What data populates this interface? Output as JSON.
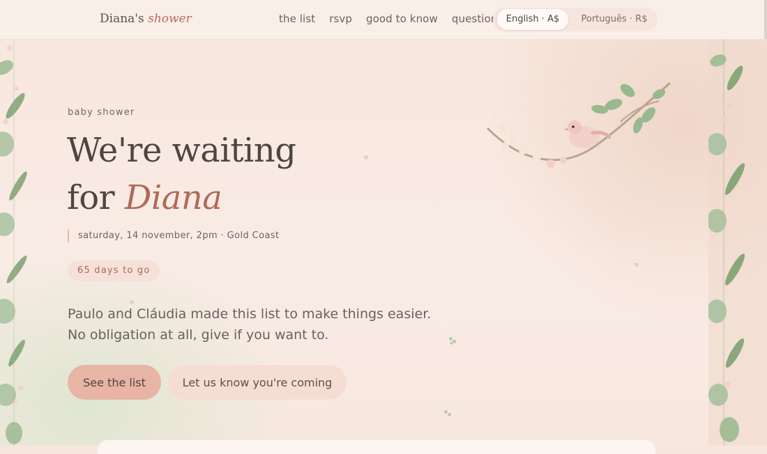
{
  "header": {
    "brand_name": "Diana's",
    "brand_accent": "shower",
    "nav": [
      {
        "label": "the list"
      },
      {
        "label": "rsvp"
      },
      {
        "label": "good to know"
      },
      {
        "label": "questions"
      }
    ],
    "languages": [
      {
        "label": "English · A$",
        "selected": true
      },
      {
        "label": "Português · R$",
        "selected": false
      }
    ]
  },
  "hero": {
    "eyebrow": "baby shower",
    "title_line1": "We're waiting",
    "title_for": "for",
    "title_name": "Diana",
    "date_line": "saturday, 14 november, 2pm · Gold Coast",
    "countdown": "65 days to go",
    "blurb_line1": "Paulo and Cláudia made this list to make things easier.",
    "blurb_line2": "No obligation at all, give if you want to.",
    "primary_button": "See the list",
    "secondary_button": "Let us know you're coming"
  },
  "decorations": {
    "left_border": "eucalyptus-leaves-icon",
    "right_border": "eucalyptus-leaves-icon",
    "branch": "bird-on-branch-icon",
    "sparkles": "blossom-sparkle-icon"
  },
  "colors": {
    "accent": "#ad6a59",
    "primary_button": "#e7b4a6",
    "secondary_button": "#f6ddd4",
    "background": "#f7e7de",
    "leaf_green": "#8fb08a"
  }
}
